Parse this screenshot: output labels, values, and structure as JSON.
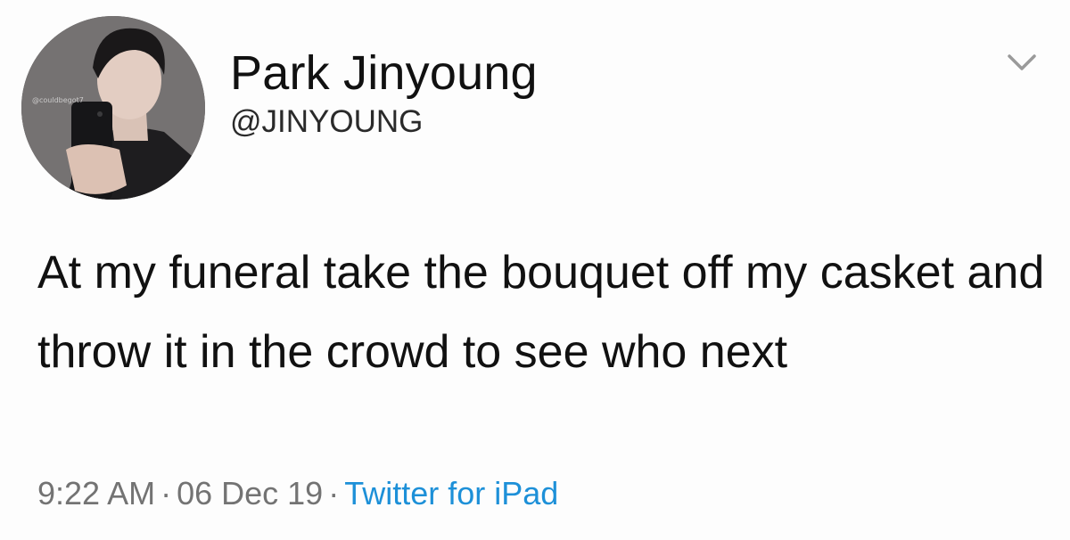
{
  "user": {
    "display_name": "Park Jinyoung",
    "handle": "@JINYOUNG",
    "avatar_watermark": "@couldbegot7",
    "avatar_icon": "profile-photo"
  },
  "menu": {
    "icon": "chevron-down-icon"
  },
  "tweet": {
    "text": "At my funeral take the bouquet off my casket and throw it in the crowd to see who next"
  },
  "meta": {
    "time": "9:22 AM",
    "separator": "·",
    "date": "06 Dec 19",
    "source": "Twitter for iPad"
  },
  "colors": {
    "text": "#111111",
    "secondary_text": "#737373",
    "link": "#1d90d8",
    "background": "#fdfdfd"
  }
}
